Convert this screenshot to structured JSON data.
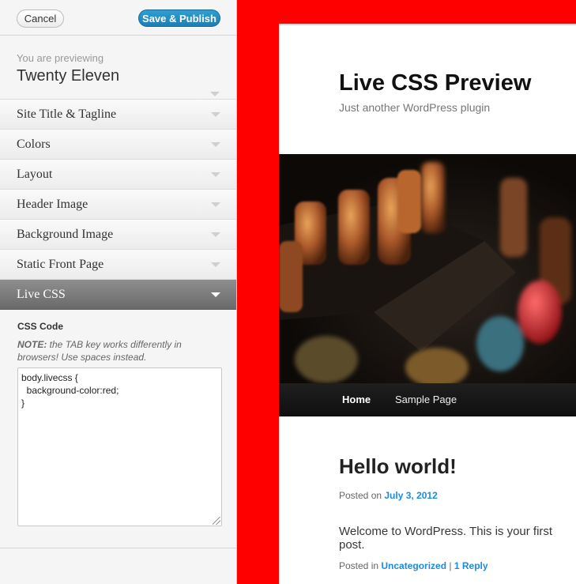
{
  "toolbar": {
    "cancel_label": "Cancel",
    "publish_label": "Save & Publish"
  },
  "previewing": {
    "label": "You are previewing",
    "theme": "Twenty Eleven"
  },
  "sections": [
    {
      "label": "Site Title & Tagline"
    },
    {
      "label": "Colors"
    },
    {
      "label": "Layout"
    },
    {
      "label": "Header Image"
    },
    {
      "label": "Background Image"
    },
    {
      "label": "Static Front Page"
    },
    {
      "label": "Live CSS"
    }
  ],
  "livecss": {
    "code_label": "CSS Code",
    "note_prefix": "NOTE:",
    "note_text": " the TAB key works differently in browsers! Use spaces instead.",
    "code_value": "body.livecss {\n  background-color:red;\n}"
  },
  "preview": {
    "site_title": "Live CSS Preview",
    "tagline": "Just another WordPress plugin",
    "nav": {
      "home": "Home",
      "sample": "Sample Page"
    },
    "post": {
      "title": "Hello world!",
      "posted_on_prefix": "Posted on ",
      "date": "July 3, 2012",
      "body": "Welcome to WordPress. This is your first post.",
      "posted_in_prefix": "Posted in ",
      "category": "Uncategorized",
      "separator": " | ",
      "reply": "1 Reply"
    }
  },
  "colors": {
    "background": "#ff0000",
    "link": "#1b8be0",
    "publish_button": "#2185bb"
  }
}
